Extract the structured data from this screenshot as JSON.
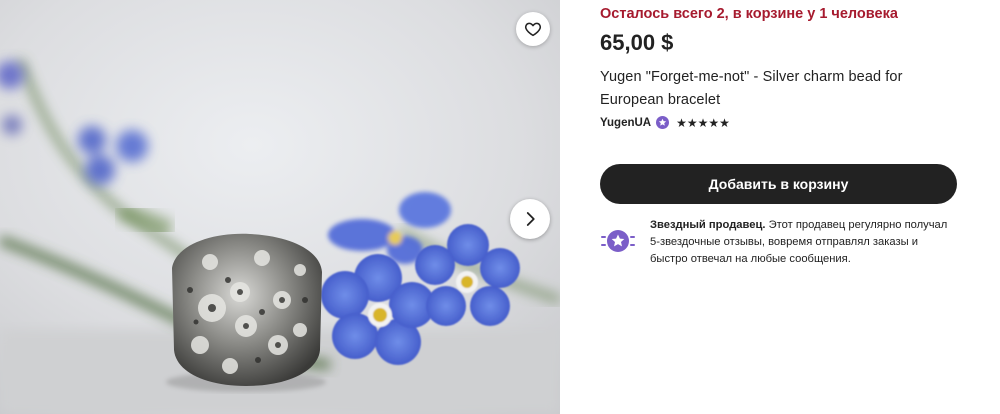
{
  "gallery": {
    "image_description_icon": "product-photo",
    "favorite_icon": "heart-icon",
    "next_icon": "chevron-right-icon"
  },
  "product": {
    "stock_note": "Осталось всего 2, в корзине у 1 человека",
    "price": "65,00 $",
    "title": "Yugen \"Forget-me-not\" - Silver charm bead for European bracelet",
    "seller_name": "YugenUA",
    "rating_stars": 5,
    "rating_glyphs": "★★★★★"
  },
  "actions": {
    "add_to_cart_label": "Добавить в корзину"
  },
  "star_seller": {
    "heading": "Звездный продавец.",
    "body": " Этот продавец регулярно получал 5-звездочные отзывы, вовремя отправлял заказы и быстро отвечал на любые сообщения."
  },
  "colors": {
    "stock_note": "#a61a2e",
    "button_bg": "#222222",
    "star_seller_purple": "#7b5ec8"
  }
}
